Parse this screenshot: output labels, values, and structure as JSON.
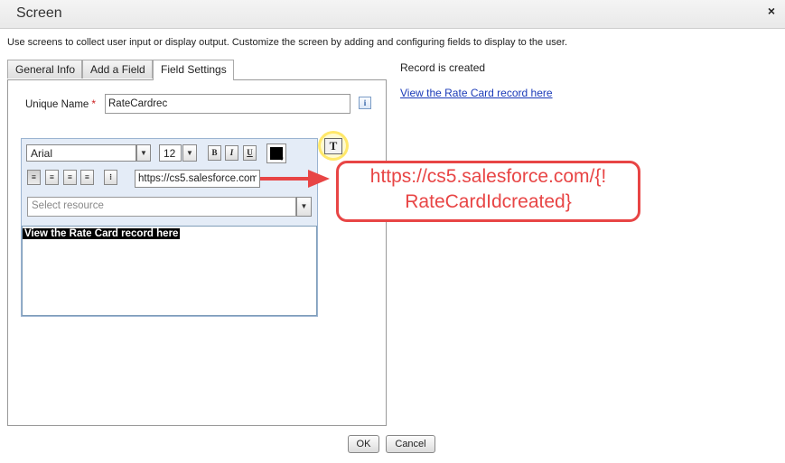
{
  "dialog": {
    "title": "Screen",
    "close_label": "×"
  },
  "description": "Use screens to collect user input or display output. Customize the screen by adding and configuring fields to display to the user.",
  "tabs": [
    {
      "label": "General Info"
    },
    {
      "label": "Add a Field"
    },
    {
      "label": "Field Settings",
      "active": true
    }
  ],
  "unique_name": {
    "label": "Unique Name",
    "required_marker": "*",
    "value": "RateCardrec",
    "info_label": "i"
  },
  "editor": {
    "font_family": "Arial",
    "font_size": "12",
    "bold_label": "B",
    "italic_label": "I",
    "underline_label": "U",
    "text_color": "#000000",
    "url_value": "https://cs5.salesforce.com/{!RateCardIdcreated}",
    "resource_placeholder": "Select resource",
    "content_text": "View the Rate Card record here",
    "hyperlink_label": "T"
  },
  "output": {
    "label": "Record is created",
    "link_text": "View the Rate Card record here"
  },
  "annotation": {
    "line1": "https://cs5.salesforce.com/{!",
    "line2": "RateCardIdcreated}",
    "color": "#e84545",
    "highlight_color": "#ffe86a"
  },
  "buttons": {
    "ok_label": "OK",
    "cancel_label": "Cancel"
  }
}
